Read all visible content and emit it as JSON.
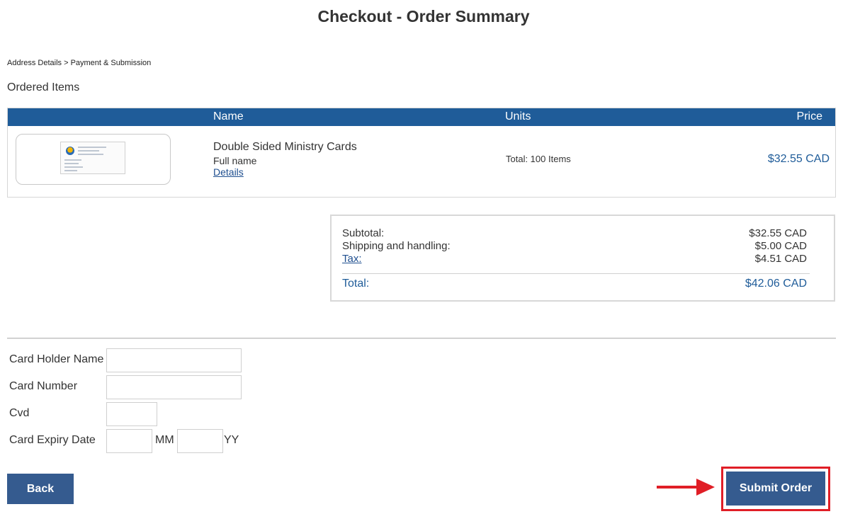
{
  "page": {
    "title": "Checkout - Order Summary",
    "breadcrumb": "Address Details > Payment & Submission",
    "section_label": "Ordered Items"
  },
  "table": {
    "headers": {
      "name": "Name",
      "units": "Units",
      "price": "Price"
    },
    "items": [
      {
        "name": "Double Sided Ministry Cards",
        "subtitle": "Full name",
        "details_link": "Details",
        "units": "Total: 100 Items",
        "price": "$32.55 CAD"
      }
    ]
  },
  "totals": {
    "subtotal_label": "Subtotal:",
    "subtotal_value": "$32.55 CAD",
    "shipping_label": "Shipping and handling:",
    "shipping_value": "$5.00 CAD",
    "tax_label": "Tax:",
    "tax_value": "$4.51 CAD",
    "total_label": "Total:",
    "total_value": "$42.06 CAD"
  },
  "payment_form": {
    "card_holder_label": "Card Holder Name",
    "card_holder_value": "",
    "card_number_label": "Card Number",
    "card_number_value": "",
    "cvd_label": "Cvd",
    "cvd_value": "",
    "expiry_label": "Card Expiry Date",
    "expiry_month_value": "",
    "expiry_month_unit": "MM",
    "expiry_year_value": "",
    "expiry_year_unit": "YY"
  },
  "buttons": {
    "back": "Back",
    "submit": "Submit Order"
  },
  "colors": {
    "header_bar": "#1f5c99",
    "button": "#355b8f",
    "highlight": "#e01e26",
    "link": "#1f4f8f"
  },
  "icons": {
    "arrow": "right-arrow-icon"
  }
}
